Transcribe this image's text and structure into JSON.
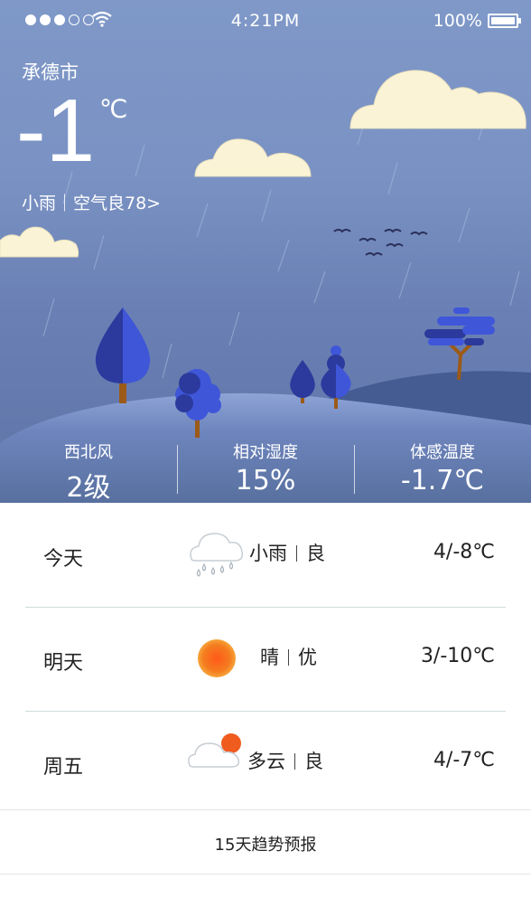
{
  "status_bar": {
    "signal_filled": 3,
    "signal_empty": 2,
    "time": "4:21PM",
    "battery": "100%"
  },
  "current": {
    "city": "承德市",
    "temperature": "-1",
    "unit": "℃",
    "summary": "小雨｜空气良78>"
  },
  "stats": [
    {
      "label": "西北风",
      "value": "2级"
    },
    {
      "label": "相对湿度",
      "value": "15%"
    },
    {
      "label": "体感温度",
      "value": "-1.7℃"
    }
  ],
  "forecast": [
    {
      "day": "今天",
      "icon": "cloud-rain-icon",
      "weather": "小雨",
      "air": "良",
      "range": "4/-8℃"
    },
    {
      "day": "明天",
      "icon": "sun-icon",
      "weather": "晴",
      "air": "优",
      "range": "3/-10℃"
    },
    {
      "day": "周五",
      "icon": "partly-cloudy-icon",
      "weather": "多云",
      "air": "良",
      "range": "4/-7℃"
    }
  ],
  "trend_link": "15天趋势预报",
  "colors": {
    "sky": "#7f98c8",
    "hill_light": "#8aa1d4",
    "hill_dark": "#3e5588",
    "cloud": "#fbf3d6",
    "tree_blue": "#3f56d9",
    "trunk": "#9b5a17",
    "sun": "#f26f1b"
  }
}
